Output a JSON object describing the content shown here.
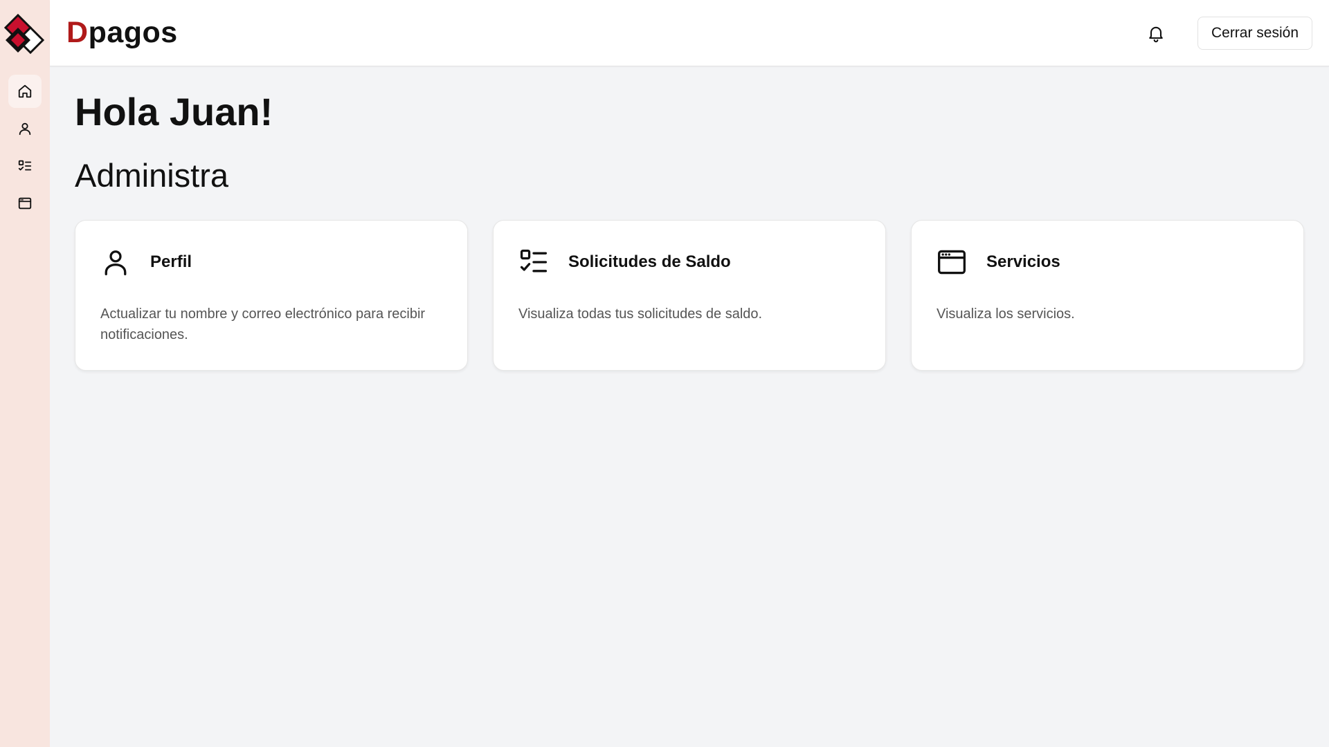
{
  "sidebar": {
    "logo": "dpagos-logo-icon",
    "items": [
      {
        "icon": "home-icon",
        "active": true
      },
      {
        "icon": "user-icon",
        "active": false
      },
      {
        "icon": "checklist-icon",
        "active": false
      },
      {
        "icon": "browser-window-icon",
        "active": false
      }
    ]
  },
  "header": {
    "brand_initial": "D",
    "brand_rest": "pagos",
    "notification_icon": "bell-icon",
    "logout_label": "Cerrar sesión"
  },
  "main": {
    "greeting": "Hola Juan!",
    "section_title": "Administra",
    "cards": [
      {
        "icon": "user-icon",
        "title": "Perfil",
        "description": "Actualizar tu nombre y correo electrónico para recibir notificaciones."
      },
      {
        "icon": "checklist-icon",
        "title": "Solicitudes de Saldo",
        "description": "Visualiza todas tus solicitudes de saldo."
      },
      {
        "icon": "browser-window-icon",
        "title": "Servicios",
        "description": "Visualiza los servicios."
      }
    ]
  },
  "colors": {
    "brand_red": "#b01a1a",
    "sidebar_bg": "#f8e5df",
    "page_bg": "#f3f4f6"
  }
}
